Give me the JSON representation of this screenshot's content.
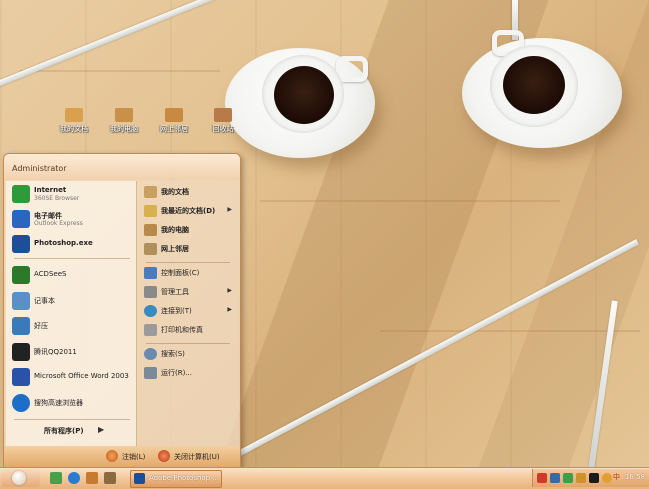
{
  "desktop": {
    "icons": [
      {
        "label": "我的文档",
        "icon": "folder-documents-icon",
        "color": "#d9a050"
      },
      {
        "label": "我的电脑",
        "icon": "computer-icon",
        "color": "#c89048"
      },
      {
        "label": "网上邻居",
        "icon": "network-icon",
        "color": "#c88a40"
      },
      {
        "label": "回收站",
        "icon": "recycle-bin-icon",
        "color": "#b87a48"
      }
    ]
  },
  "start_menu": {
    "user": "Administrator",
    "pinned": [
      {
        "title": "Internet",
        "subtitle": "360SE Browser",
        "icon": "browser-360-icon",
        "color": "#2f9a3a"
      },
      {
        "title": "电子邮件",
        "subtitle": "Outlook Express",
        "icon": "mail-icon",
        "color": "#2a66c0"
      }
    ],
    "recent": [
      {
        "title": "Photoshop.exe",
        "icon": "photoshop-icon",
        "color": "#1c4f98"
      },
      {
        "title": "ACDSeeS",
        "icon": "acdsee-icon",
        "color": "#2a7a2a"
      },
      {
        "title": "记事本",
        "icon": "notepad-icon",
        "color": "#5b8fc8"
      },
      {
        "title": "好压",
        "icon": "haozip-icon",
        "color": "#3a7ab8"
      },
      {
        "title": "腾讯QQ2011",
        "icon": "qq-icon",
        "color": "#222222"
      },
      {
        "title": "Microsoft Office Word 2003",
        "icon": "word-icon",
        "color": "#2a52a8"
      },
      {
        "title": "搜狗高速浏览器",
        "icon": "sogou-browser-icon",
        "color": "#1e6ec8"
      }
    ],
    "all_programs": "所有程序(P)",
    "places": [
      {
        "label": "我的文档",
        "icon": "my-documents-icon",
        "color": "#c9a060",
        "arrow": "",
        "bold": true
      },
      {
        "label": "我最近的文档(D)",
        "icon": "recent-documents-icon",
        "color": "#d8b050",
        "arrow": "▶",
        "bold": true
      },
      {
        "label": "我的电脑",
        "icon": "my-computer-icon",
        "color": "#b88a4a",
        "arrow": "",
        "bold": true
      },
      {
        "label": "网上邻居",
        "icon": "network-places-icon",
        "color": "#b0905a",
        "arrow": "",
        "bold": true
      }
    ],
    "settings": [
      {
        "label": "控制面板(C)",
        "icon": "control-panel-icon",
        "color": "#4a7ac0",
        "arrow": "",
        "bold": false
      },
      {
        "label": "管理工具",
        "icon": "admin-tools-icon",
        "color": "#8a8a8a",
        "arrow": "▶",
        "bold": false
      },
      {
        "label": "连接到(T)",
        "icon": "connect-to-icon",
        "color": "#3a8ac0",
        "arrow": "▶",
        "bold": false
      },
      {
        "label": "打印机和传真",
        "icon": "printer-icon",
        "color": "#9a9a9a",
        "arrow": "",
        "bold": false
      }
    ],
    "tools": [
      {
        "label": "搜索(S)",
        "icon": "search-icon",
        "color": "#6a8ab0",
        "arrow": "",
        "bold": false
      },
      {
        "label": "运行(R)...",
        "icon": "run-icon",
        "color": "#7a8a9a",
        "arrow": "",
        "bold": false
      }
    ],
    "footer": {
      "logoff": "注销(L)",
      "shutdown": "关闭计算机(U)"
    }
  },
  "taskbar": {
    "quick_launch": [
      {
        "icon": "show-desktop-icon",
        "color": "#4aa04a"
      },
      {
        "icon": "ie-icon",
        "color": "#2a7ad0"
      },
      {
        "icon": "media-player-icon",
        "color": "#c87a30"
      },
      {
        "icon": "explorer-icon",
        "color": "#8a6a40"
      }
    ],
    "active_task": "Adobe Photoshop ...",
    "tray_icons": [
      {
        "icon": "sogou-input-icon",
        "color": "#d03a2a"
      },
      {
        "icon": "network-tray-icon",
        "color": "#3a6aa0"
      },
      {
        "icon": "360-tray-icon",
        "color": "#3aa04a"
      },
      {
        "icon": "security-tray-icon",
        "color": "#d0902a"
      },
      {
        "icon": "qq-tray-icon",
        "color": "#1a1a1a"
      },
      {
        "icon": "volume-tray-icon",
        "color": "#e0a030"
      }
    ],
    "ime": "中",
    "clock": "16:58"
  }
}
